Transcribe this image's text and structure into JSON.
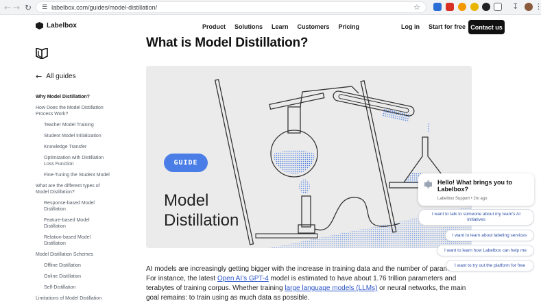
{
  "browser": {
    "url": "labelbox.com/guides/model-distillation/",
    "back_icon": "arrow-left",
    "forward_icon": "arrow-right",
    "reload_icon": "reload"
  },
  "header": {
    "brand": "Labelbox",
    "nav": [
      "Product",
      "Solutions",
      "Learn",
      "Customers",
      "Pricing"
    ],
    "login": "Log in",
    "start_free": "Start for free",
    "contact": "Contact us"
  },
  "sidebar": {
    "all_guides": "All guides",
    "toc": [
      {
        "label": "Why Model Distillation?",
        "level": 0,
        "active": true
      },
      {
        "label": "How Does the Model Distillation Process Work?",
        "level": 0,
        "active": false
      },
      {
        "label": "Teacher Model Training",
        "level": 1,
        "active": false
      },
      {
        "label": "Student Model Initialization",
        "level": 1,
        "active": false
      },
      {
        "label": "Knowledge Transfer",
        "level": 1,
        "active": false
      },
      {
        "label": "Optimization with Distillation Loss Function",
        "level": 1,
        "active": false
      },
      {
        "label": "Fine-Tuning the Student Model",
        "level": 1,
        "active": false
      },
      {
        "label": "What are the different types of Model Distillation?",
        "level": 0,
        "active": false
      },
      {
        "label": "Response-based Model Distillation",
        "level": 1,
        "active": false
      },
      {
        "label": "Feature-based Model Distillation",
        "level": 1,
        "active": false
      },
      {
        "label": "Relation-based Model Distillation",
        "level": 1,
        "active": false
      },
      {
        "label": "Model Distillation Schemes",
        "level": 0,
        "active": false
      },
      {
        "label": "Offline Distillation",
        "level": 1,
        "active": false
      },
      {
        "label": "Online Distillation",
        "level": 1,
        "active": false
      },
      {
        "label": "Self-Distillation",
        "level": 1,
        "active": false
      },
      {
        "label": "Limitations of Model Distillation",
        "level": 0,
        "active": false
      }
    ]
  },
  "main": {
    "title": "What is Model Distillation?",
    "hero": {
      "pill": "GUIDE",
      "line1": "Model",
      "line2": "Distillation"
    },
    "para": {
      "t1": "AI models are increasingly getting bigger with the increase in training data and the number of parameters. For instance, the latest ",
      "link1": "Open AI’s GPT-4",
      "t2": " model is estimated to have about 1.76 trillion parameters and terabytes of training corpus. Whether training ",
      "link2": "large language models (LLMs)",
      "t3": " or neural networks, the main goal remains: to train using as much data as possible."
    }
  },
  "chat": {
    "greeting": "Hello! What brings you to Labelbox?",
    "meta": "Labelbox Support • 2m ago",
    "options": [
      "I want to talk to someone about my team's AI initiatives",
      "I want to learn about labeling services",
      "I want to learn how Labelbox can help me",
      "I want to try out the platform for free"
    ]
  },
  "colors": {
    "accent_blue": "#4a7ee6",
    "link_blue": "#2953c9",
    "hero_bg": "#ebebeb",
    "dark_button": "#111111"
  }
}
